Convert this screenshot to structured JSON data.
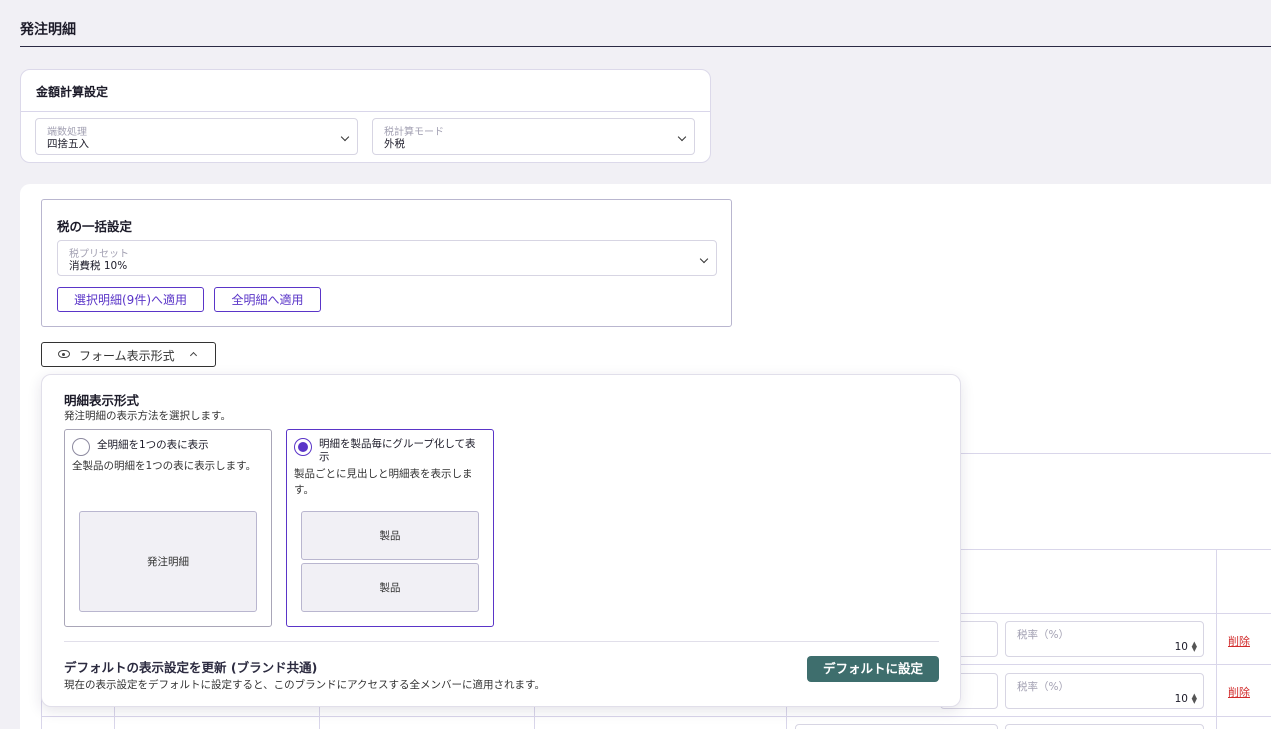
{
  "page_title": "発注明細",
  "calc_settings": {
    "title": "金額計算設定",
    "rounding": {
      "label": "端数処理",
      "value": "四捨五入"
    },
    "tax_mode": {
      "label": "税計算モード",
      "value": "外税"
    }
  },
  "tax_bulk": {
    "title": "税の一括設定",
    "preset": {
      "label": "税プリセット",
      "value": "消費税 10%"
    },
    "apply_selected": "選択明細(9件)へ適用",
    "apply_all": "全明細へ適用"
  },
  "form_toggle": {
    "label": "フォーム表示形式",
    "icon": "eye-icon"
  },
  "popover": {
    "title": "明細表示形式",
    "subtitle": "発注明細の表示方法を選択します。",
    "options": [
      {
        "label": "全明細を1つの表に表示",
        "description": "全製品の明細を1つの表に表示します。",
        "selected": false,
        "preview": [
          "発注明細"
        ]
      },
      {
        "label": "明細を製品毎にグループ化して表示",
        "description": "製品ごとに見出しと明細表を表示します。",
        "selected": true,
        "preview": [
          "製品",
          "製品"
        ]
      }
    ],
    "default_title": "デフォルトの表示設定を更新 (ブランド共通)",
    "default_desc": "現在の表示設定をデフォルトに設定すると、このブランドにアクセスする全メンバーに適用されます。",
    "default_button": "デフォルトに設定"
  },
  "table_rows": [
    {
      "rate_label": "税率（%）",
      "rate_value": "10",
      "delete": "削除"
    },
    {
      "rate_label": "税率（%）",
      "rate_value": "10",
      "delete": "削除"
    }
  ],
  "colors": {
    "accent": "#5a35c8",
    "primary_button": "#3e6e6d",
    "danger": "#d12b2b"
  }
}
